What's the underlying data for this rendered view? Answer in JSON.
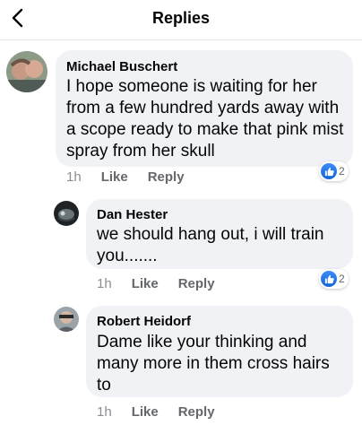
{
  "header": {
    "title": "Replies"
  },
  "comments": [
    {
      "author": "Michael Buschert",
      "text": "I hope someone is waiting for her from a few hundred yards away with a scope ready to make that pink mist spray from her skull",
      "time": "1h",
      "like_label": "Like",
      "reply_label": "Reply",
      "reaction_count": "2"
    },
    {
      "author": "Dan Hester",
      "text": "we should hang out, i will train you.......",
      "time": "1h",
      "like_label": "Like",
      "reply_label": "Reply",
      "reaction_count": "2"
    },
    {
      "author": "Robert Heidorf",
      "text": "Dame like your thinking and many more in them cross hairs to",
      "time": "1h",
      "like_label": "Like",
      "reply_label": "Reply"
    }
  ],
  "colors": {
    "bubble": "#f0f2f5",
    "like_blue": "#1877f2",
    "meta_gray": "#65676b"
  },
  "icons": {
    "back": "chevron-left-icon",
    "reaction": "thumbs-up-icon"
  }
}
